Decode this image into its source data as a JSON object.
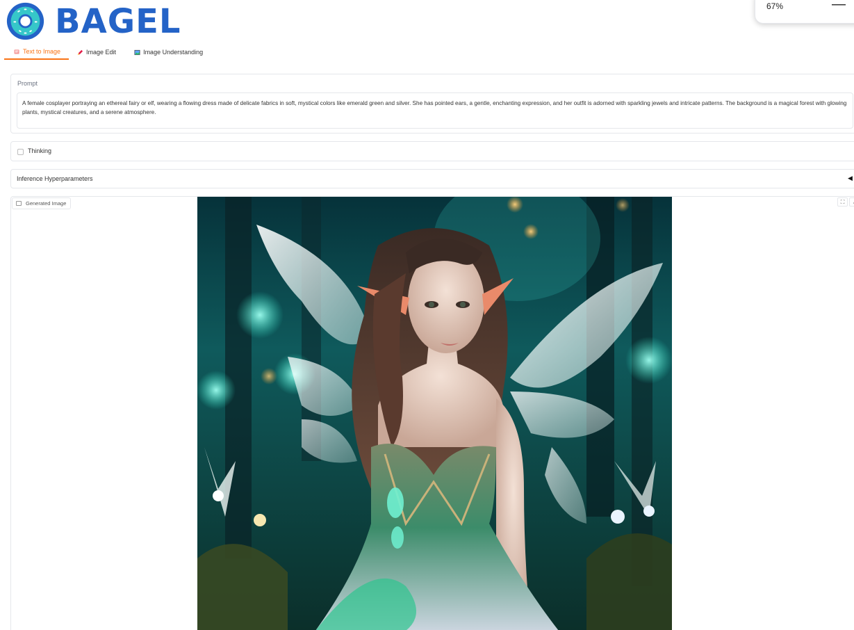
{
  "app": {
    "name": "BAGEL",
    "brand_color": "#2463c7",
    "accent_color": "#f97316"
  },
  "zoom": {
    "value": "67%",
    "minus_symbol": "—"
  },
  "tabs": [
    {
      "label": "Text to Image",
      "icon": "pencil-palette-icon",
      "active": true
    },
    {
      "label": "Image Edit",
      "icon": "pencil-icon",
      "active": false
    },
    {
      "label": "Image Understanding",
      "icon": "framed-picture-icon",
      "active": false
    }
  ],
  "prompt": {
    "label": "Prompt",
    "value": "A female cosplayer portraying an ethereal fairy or elf, wearing a flowing dress made of delicate fabrics in soft, mystical colors like emerald green and silver. She has pointed ears, a gentle, enchanting expression, and her outfit is adorned with sparkling jewels and intricate patterns. The background is a magical forest with glowing plants, mystical creatures, and a serene atmosphere."
  },
  "thinking": {
    "label": "Thinking",
    "checked": false
  },
  "hyperparameters": {
    "label": "Inference Hyperparameters",
    "caret": "◀"
  },
  "output": {
    "label": "Generated Image",
    "tools": [
      "fullscreen-icon",
      "download-icon"
    ]
  },
  "image": {
    "bands": [
      "#06323a",
      "#0f5a5c",
      "#2a7b6e",
      "#d9c7bb",
      "#e8d5c8",
      "#3c8c6a",
      "#cbd5df"
    ],
    "orbs": [
      {
        "color": "#7fffe8"
      },
      {
        "color": "#8fffe0"
      },
      {
        "color": "#6fe7ff"
      },
      {
        "color": "#ffb347"
      },
      {
        "color": "#ffd27f"
      },
      {
        "color": "#7fffe8"
      },
      {
        "color": "#ffffff"
      }
    ]
  }
}
